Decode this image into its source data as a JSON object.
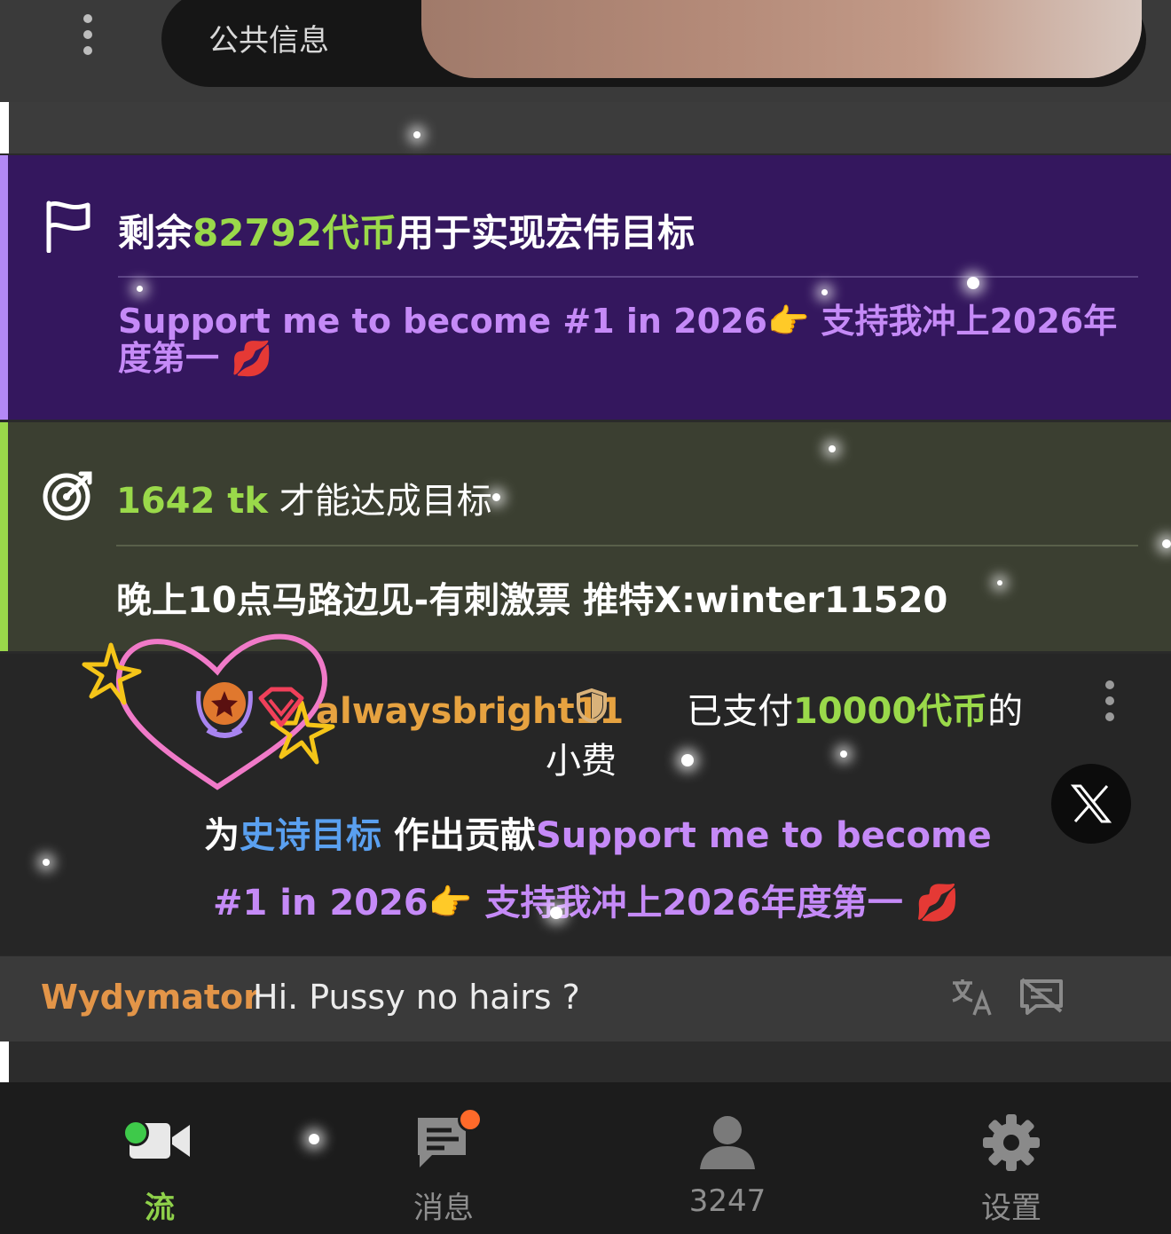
{
  "header": {
    "public_info_label": "公共信息"
  },
  "goal": {
    "title_prefix": "剩余",
    "tokens_left": "82792代币",
    "title_suffix": "用于实现宏伟目标",
    "description": "Support me to become #1 in 2026👉 支持我冲上2026年度第一 💋"
  },
  "target": {
    "amount": "1642 tk",
    "title_suffix": " 才能达成目标",
    "description": "晚上10点马路边见-有刺激票 推特X:winter11520"
  },
  "tip": {
    "username": "alwaysbright11",
    "paid_prefix": " 已支付",
    "amount": "10000代币",
    "paid_suffix": "的",
    "line2": "小费",
    "contribute_prefix": "为",
    "epic_goal": "史诗目标",
    "contribute_mid": " 作出贡献",
    "goal_text_1": "Support me to become",
    "goal_text_2": "#1 in 2026👉 支持我冲上2026年度第一 💋"
  },
  "chat": {
    "username": "Wydymator",
    "message": "Hi. Pussy no hairs ?"
  },
  "bottom_nav": {
    "stream_label": "流",
    "messages_label": "消息",
    "viewers_count": "3247",
    "settings_label": "设置"
  },
  "colors": {
    "accent_green": "#9ad94a",
    "goal_purple": "#34175e",
    "goal_text_purple": "#c58af7",
    "username_orange": "#e6a240",
    "notification_orange": "#ff6a2a",
    "live_green": "#3ec94a"
  },
  "icons": [
    "kebab-menu-icon",
    "flag-icon",
    "target-icon",
    "star-badge-icon",
    "diamond-badge-icon",
    "shield-icon",
    "x-logo-icon",
    "translate-icon",
    "hide-message-icon",
    "video-camera-icon",
    "chat-bubble-icon",
    "person-icon",
    "gear-icon"
  ]
}
